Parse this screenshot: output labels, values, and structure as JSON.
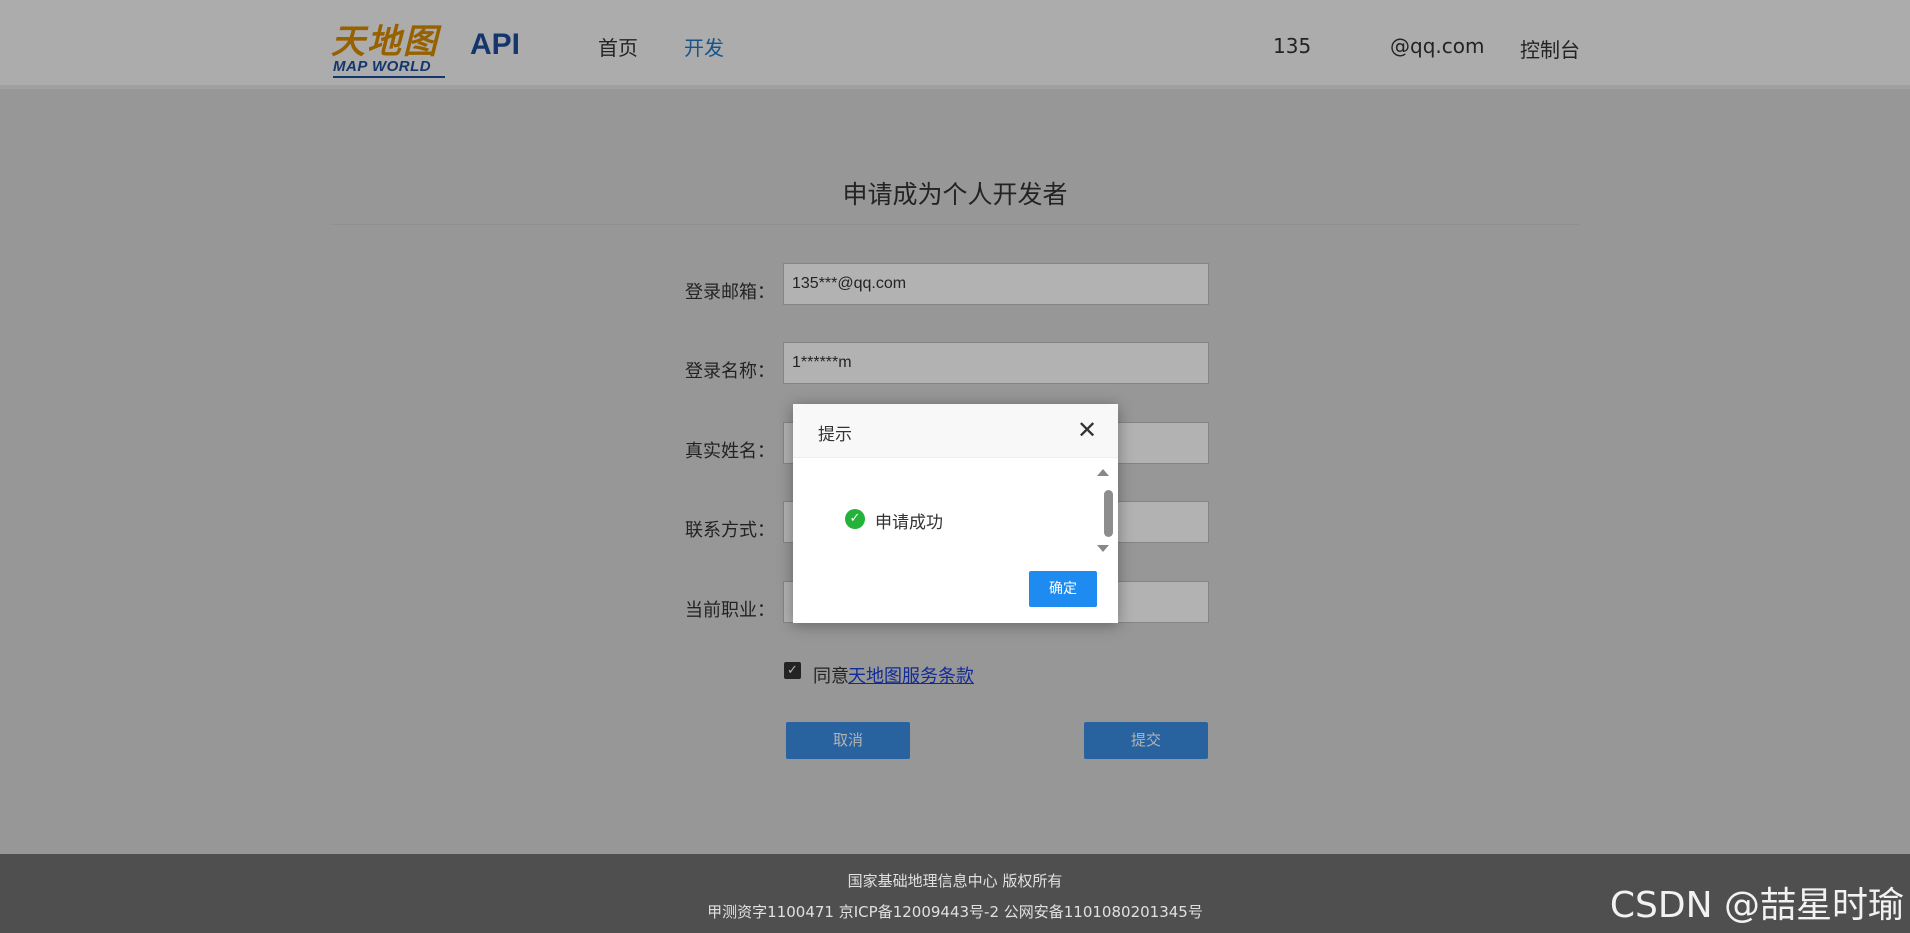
{
  "header": {
    "logo_cn": "天地图",
    "logo_en": "MAP WORLD",
    "api_label": "API",
    "nav": {
      "home": "首页",
      "develop": "开发"
    },
    "user": {
      "phone": "135",
      "email": "@qq.com",
      "console": "控制台"
    }
  },
  "main": {
    "title": "申请成为个人开发者",
    "fields": {
      "email": {
        "label": "登录邮箱：",
        "value": "135***@qq.com"
      },
      "username": {
        "label": "登录名称：",
        "value": "1******m"
      },
      "realname": {
        "label": "真实姓名：",
        "value": ""
      },
      "contact": {
        "label": "联系方式：",
        "value": ""
      },
      "occupation": {
        "label": "当前职业：",
        "value": ""
      }
    },
    "agree": {
      "checked": true,
      "text": "同意",
      "link": "天地图服务条款"
    },
    "buttons": {
      "cancel": "取消",
      "submit": "提交"
    }
  },
  "footer": {
    "line1": "国家基础地理信息中心  版权所有",
    "line2": "甲测资字1100471  京ICP备12009443号-2  公网安备1101080201345号"
  },
  "watermark": "CSDN @喆星时瑜",
  "dialog": {
    "title": "提示",
    "message": "申请成功",
    "ok": "确定",
    "icons": {
      "close": "close-icon",
      "status": "success-check-icon"
    }
  },
  "colors": {
    "accent": "#1e8bf0",
    "brand_blue": "#1f4e9c",
    "logo_orange": "#d98b00",
    "success": "#24b33a",
    "footer_bg": "#4f4f4f"
  }
}
